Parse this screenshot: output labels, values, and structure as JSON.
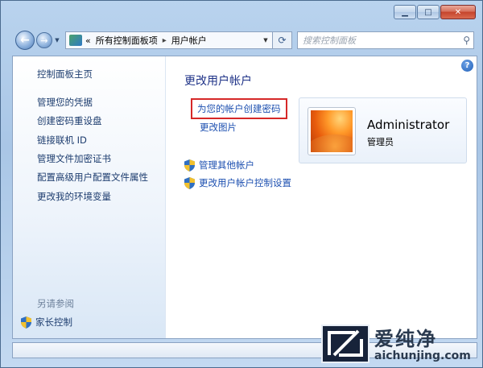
{
  "window": {
    "caption_buttons": {
      "minimize": "▁",
      "maximize": "□",
      "close": "✕"
    }
  },
  "address": {
    "back_icon": "back-arrow-icon",
    "forward_icon": "forward-arrow-icon",
    "chevron": "«",
    "breadcrumb_1": "所有控制面板项",
    "separator": "▸",
    "breadcrumb_2": "用户帐户",
    "search_placeholder": "搜索控制面板"
  },
  "sidebar": {
    "items": [
      {
        "label": "控制面板主页"
      },
      {
        "label": "管理您的凭据"
      },
      {
        "label": "创建密码重设盘"
      },
      {
        "label": "链接联机 ID"
      },
      {
        "label": "管理文件加密证书"
      },
      {
        "label": "配置高级用户配置文件属性"
      },
      {
        "label": "更改我的环境变量"
      }
    ],
    "see_also": "另请参阅",
    "parental_controls": "家长控制"
  },
  "main": {
    "title": "更改用户帐户",
    "tasks": [
      {
        "label": "为您的帐户创建密码",
        "highlighted": true
      },
      {
        "label": "更改图片"
      }
    ],
    "admin_tasks": [
      {
        "label": "管理其他帐户"
      },
      {
        "label": "更改用户帐户控制设置"
      }
    ]
  },
  "user": {
    "name": "Administrator",
    "role": "管理员"
  },
  "watermark": {
    "title": "爱纯净",
    "url": "aichunjing.com"
  },
  "colors": {
    "link": "#1c4fb0",
    "title": "#1e3287",
    "highlight_box": "#d62828"
  }
}
